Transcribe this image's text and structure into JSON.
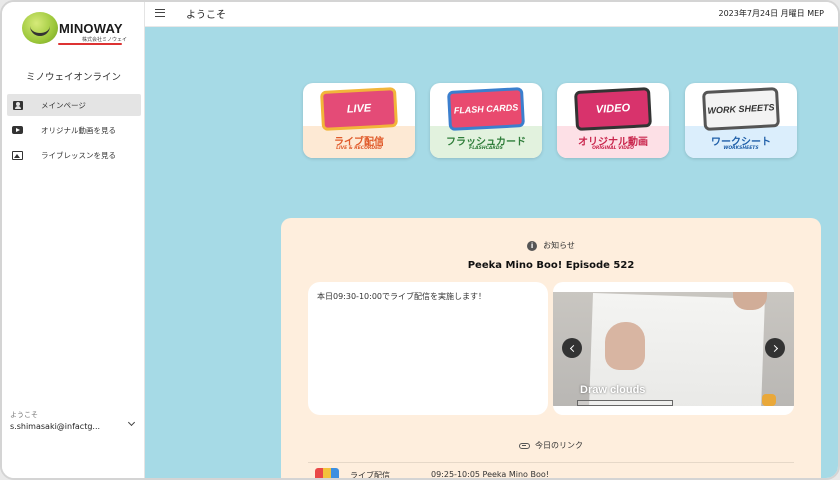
{
  "brand": {
    "name": "MINOWAY",
    "subname": "株式会社ミノウェイ",
    "app_name": "ミノウェイオンライン"
  },
  "sidebar": {
    "items": [
      {
        "label": "メインページ",
        "icon": "account-box-icon",
        "active": true
      },
      {
        "label": "オリジナル動画を見る",
        "icon": "youtube-play-icon",
        "active": false
      },
      {
        "label": "ライブレッスンを見る",
        "icon": "photo-library-icon",
        "active": false
      }
    ],
    "user": {
      "greeting": "ようこそ",
      "email": "s.shimasaki@infactg..."
    }
  },
  "topbar": {
    "title": "ようこそ",
    "date_text": "2023年7月24日 月曜日 MEP"
  },
  "tiles": [
    {
      "art": "LIVE",
      "label": "ライブ配信",
      "sub": "LIVE & RECORDED",
      "color": "#e05a2a",
      "art_bg": "#e44b77",
      "band": "#fde9d4"
    },
    {
      "art": "FLASH CARDS",
      "label": "フラッシュカード",
      "sub": "FLASHCARDS",
      "color": "#2f7d3a",
      "art_bg": "#e94a6f",
      "band": "#e2f2de"
    },
    {
      "art": "VIDEO",
      "label": "オリジナル動画",
      "sub": "ORIGINAL VIDEO",
      "color": "#c9264d",
      "art_bg": "#d8336c",
      "band": "#fde0e6"
    },
    {
      "art": "WORK SHEETS",
      "label": "ワークシート",
      "sub": "WORKSHEETS",
      "color": "#1e5ea8",
      "art_bg": "#7a8fa6",
      "band": "#dbeefc"
    }
  ],
  "news": {
    "heading": "お知らせ",
    "episode_title": "Peeka Mino Boo! Episode 522",
    "message": "本日09:30-10:00でライブ配信を実施します！",
    "slide_caption": "Draw clouds"
  },
  "links": {
    "heading": "今日のリンク",
    "items": [
      {
        "name": "ライブ配信",
        "time": "09:25-10:05 Peeka Mino Boo!"
      }
    ]
  },
  "colors": {
    "main_bg": "#a6dae6",
    "card_bg": "#feeedd",
    "active_nav": "#e4e4e4"
  }
}
